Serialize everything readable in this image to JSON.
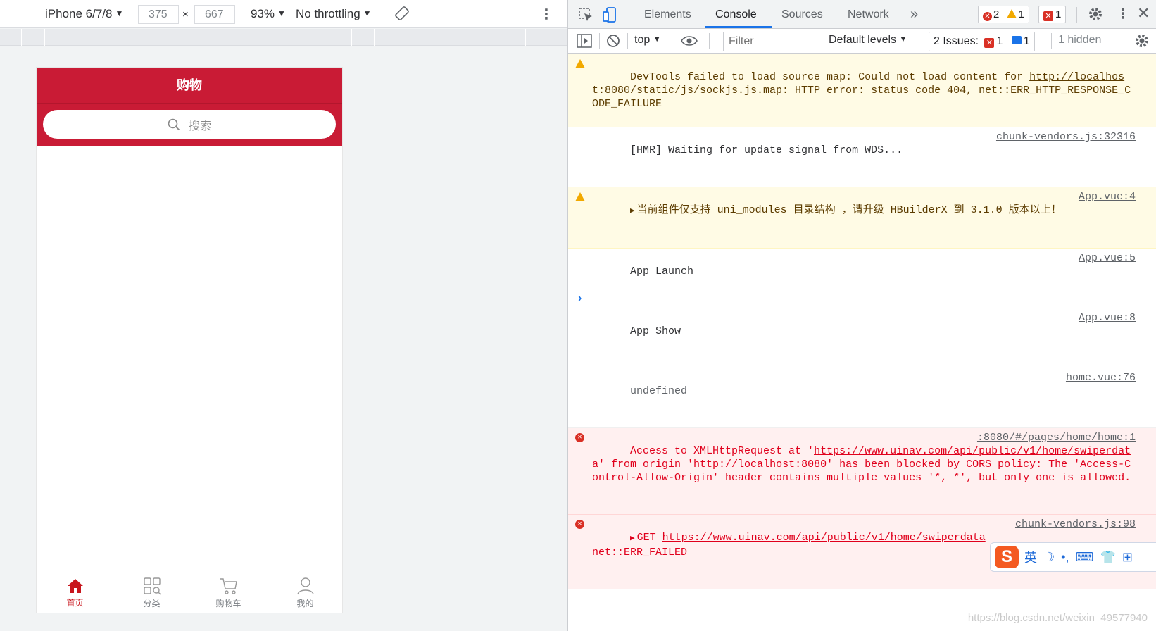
{
  "device_toolbar": {
    "device": "iPhone 6/7/8",
    "width": "375",
    "times": "×",
    "height": "667",
    "zoom": "93%",
    "throttling": "No throttling"
  },
  "app": {
    "title": "购物",
    "search_placeholder": "搜索",
    "tabs": [
      {
        "label": "首页",
        "icon": "home-icon",
        "active": true
      },
      {
        "label": "分类",
        "icon": "category-icon",
        "active": false
      },
      {
        "label": "购物车",
        "icon": "cart-icon",
        "active": false
      },
      {
        "label": "我的",
        "icon": "user-icon",
        "active": false
      }
    ],
    "accent": "#c91b35"
  },
  "devtools": {
    "tabs": [
      "Elements",
      "Console",
      "Sources",
      "Network"
    ],
    "active_tab": "Console",
    "badges": {
      "errors": "2",
      "warnings": "1",
      "issues": "1"
    },
    "console_bar": {
      "context": "top",
      "filter_placeholder": "Filter",
      "levels": "Default levels",
      "issues_label": "2 Issues:",
      "issues_errors": "1",
      "issues_info": "1",
      "hidden": "1 hidden"
    },
    "messages": [
      {
        "type": "warn",
        "text_a": "DevTools failed to load source map: Could not load content for ",
        "link": "http://localhost:8080/static/js/sockjs.js.map",
        "text_b": ": HTTP error: status code 404, net::ERR_HTTP_RESPONSE_CODE_FAILURE"
      },
      {
        "type": "log",
        "text": "[HMR] Waiting for update signal from WDS...",
        "source": "chunk-vendors.js:32316"
      },
      {
        "type": "warn",
        "text": "当前组件仅支持 uni_modules 目录结构 ，请升级 HBuilderX 到 3.1.0 版本以上！",
        "source": "App.vue:4"
      },
      {
        "type": "log",
        "text": "App Launch",
        "source": "App.vue:5"
      },
      {
        "type": "log",
        "text": "App Show",
        "source": "App.vue:8"
      },
      {
        "type": "log",
        "text": "undefined",
        "source": "home.vue:76"
      },
      {
        "type": "error",
        "text_a": "Access to XMLHttpRequest at '",
        "link_a": "https://www.uinav.com/api/public/v1/home/swiperdata",
        "text_b": "' from origin '",
        "link_b": "http://localhost:8080",
        "text_c": "' has been blocked by CORS policy: The 'Access-Control-Allow-Origin' header contains multiple values '*, *', but only one is allowed.",
        "source": ":8080/#/pages/home/home:1"
      },
      {
        "type": "error",
        "text_a": "GET ",
        "link": "https://www.uinav.com/api/public/v1/home/swiperdata",
        "text_b": "net::ERR_FAILED",
        "source": "chunk-vendors.js:98"
      }
    ]
  },
  "ime": {
    "lang": "英",
    "logo": "S"
  },
  "watermark": "https://blog.csdn.net/weixin_49577940"
}
